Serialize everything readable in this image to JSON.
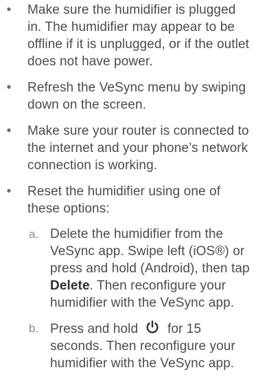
{
  "bullets": [
    {
      "marker": "•",
      "text": "Make sure the humidifier is plugged in. The humidifier may appear to be offline if it is unplugged, or if the outlet does not have power."
    },
    {
      "marker": "•",
      "text": "Refresh the VeSync menu by swiping down on the screen."
    },
    {
      "marker": "•",
      "text": "Make sure your router is connected to the internet and your phone’s network connection is working."
    },
    {
      "marker": "•",
      "text": "Reset the humidifier using one of these options:"
    }
  ],
  "reset_options": [
    {
      "marker": "a.",
      "text_before": "Delete the humidifier from the VeSync app. Swipe left (iOS®) or press and hold (Android), then tap ",
      "bold": "Delete",
      "text_after": ". Then reconfigure your humidifier with the VeSync app."
    },
    {
      "marker": "b.",
      "text_before": "Press and hold",
      "icon": "power-icon",
      "text_after": "for 15 seconds. Then reconfigure your humidifier with the VeSync app."
    }
  ]
}
